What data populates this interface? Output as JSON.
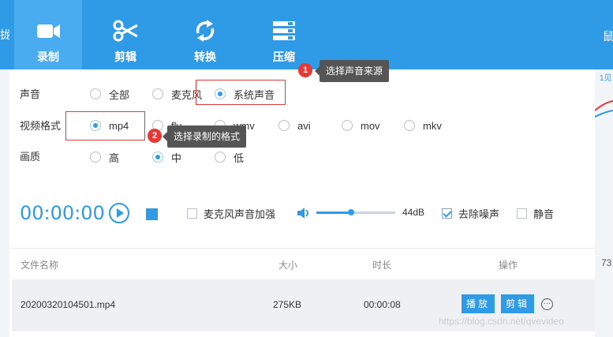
{
  "toolbar": {
    "items": [
      {
        "label": "录制",
        "icon": "video-camera-icon",
        "active": true
      },
      {
        "label": "剪辑",
        "icon": "scissors-icon",
        "active": false
      },
      {
        "label": "转换",
        "icon": "convert-arrows-icon",
        "active": false
      },
      {
        "label": "压缩",
        "icon": "compress-icon",
        "active": false
      }
    ]
  },
  "edges": {
    "left_text": "拢",
    "right_text": "鼠",
    "right_small": "1见",
    "right_num": "73"
  },
  "sound": {
    "label": "声音",
    "options": [
      "全部",
      "麦克风",
      "系统声音"
    ],
    "selected": "系统声音"
  },
  "format": {
    "label": "视频格式",
    "options": [
      "mp4",
      "flv",
      "wmv",
      "avi",
      "mov",
      "mkv"
    ],
    "selected": "mp4"
  },
  "quality": {
    "label": "画质",
    "options": [
      "高",
      "中",
      "低"
    ],
    "selected": "中"
  },
  "callouts": [
    {
      "number": "1",
      "text": "选择声音来源"
    },
    {
      "number": "2",
      "text": "选择录制的格式"
    }
  ],
  "recorder": {
    "timer": "00:00:00",
    "mic_boost_label": "麦克风声音加强",
    "mic_boost_checked": false,
    "volume_level_percent": 44,
    "volume_text": "44dB",
    "denoise_label": "去除噪声",
    "denoise_checked": true,
    "mute_label": "静音",
    "mute_checked": false
  },
  "table": {
    "headers": [
      "文件名称",
      "大小",
      "时长",
      "操作"
    ],
    "rows": [
      {
        "name": "20200320104501.mp4",
        "size": "275KB",
        "duration": "00:00:08",
        "play": "播放",
        "edit": "剪辑",
        "more": "···"
      }
    ]
  },
  "watermark": "https://blog.csdn.net/qvevideo",
  "colors": {
    "accent": "#2f9ae6",
    "callout_bg": "#555555",
    "badge": "#e53935",
    "highlight_box": "#e03a3a"
  }
}
